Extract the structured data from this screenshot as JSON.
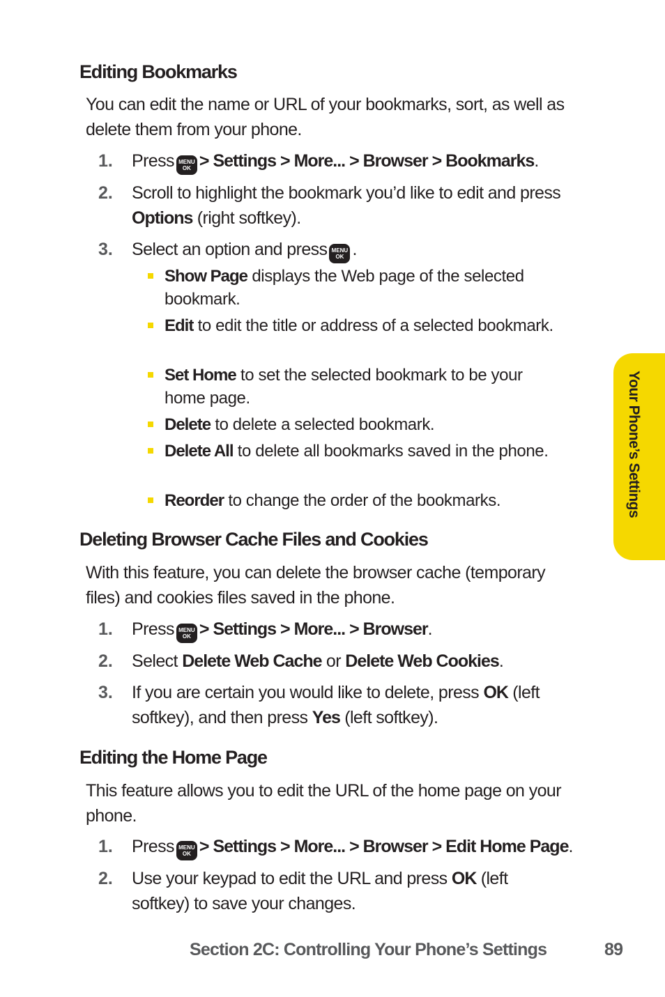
{
  "side_tab": {
    "label": "Your Phone’s Settings",
    "color": "#f5d800"
  },
  "key_icon": {
    "line1": "MENU",
    "line2": "OK"
  },
  "sections": [
    {
      "title": "Editing Bookmarks",
      "intro": "You can edit the name or URL of your bookmarks, sort, as well as delete them from your phone.",
      "steps": [
        {
          "num": "1.",
          "pre": "Press",
          "path": "> Settings > More... > Browser > Bookmarks",
          "post": "."
        },
        {
          "num": "2.",
          "pre": "Scroll to highlight the bookmark you’d like to edit and press",
          "bold": "Options",
          "post": "(right softkey)."
        },
        {
          "num": "3.",
          "pre": "Select an option and press",
          "post": "."
        }
      ],
      "options": [
        {
          "bold": "Show Page",
          "text": "displays the Web page of the selected bookmark."
        },
        {
          "bold": "Edit",
          "text": "to edit the title or address of a selected bookmark."
        },
        {
          "bold": "Set Home",
          "text": "to set the selected bookmark to be your home page."
        },
        {
          "bold": "Delete",
          "text": "to delete a selected bookmark."
        },
        {
          "bold": "Delete All",
          "text": "to delete all bookmarks saved in the phone."
        },
        {
          "bold": "Reorder",
          "text": "to change the order of the bookmarks."
        }
      ]
    },
    {
      "title": "Deleting Browser Cache Files and Cookies",
      "intro": "With this feature, you can delete the browser cache (temporary files) and cookies files saved in the phone.",
      "steps": [
        {
          "num": "1.",
          "pre": "Press",
          "path": "> Settings > More... > Browser",
          "post": "."
        },
        {
          "num": "2.",
          "pre": "Select",
          "bold1": "Delete Web Cache",
          "mid": "or",
          "bold2": "Delete Web Cookies",
          "post": "."
        },
        {
          "num": "3.",
          "pre": "If you are certain you would like to delete, press",
          "bold1": "OK",
          "mid": "(left softkey), and then press",
          "bold2": "Yes",
          "post": "(left softkey)."
        }
      ]
    },
    {
      "title": "Editing the Home Page",
      "intro": "This feature allows you to edit the URL of the home page on your phone.",
      "steps": [
        {
          "num": "1.",
          "pre": "Press",
          "path": "> Settings > More... > Browser > Edit Home Page",
          "post": "."
        },
        {
          "num": "2.",
          "pre": "Use your keypad to edit the URL and press",
          "bold": "OK",
          "post": "(left softkey) to save your changes."
        }
      ]
    }
  ],
  "footer": {
    "section": "Section 2C: Controlling Your Phone’s Settings",
    "page": "89"
  }
}
